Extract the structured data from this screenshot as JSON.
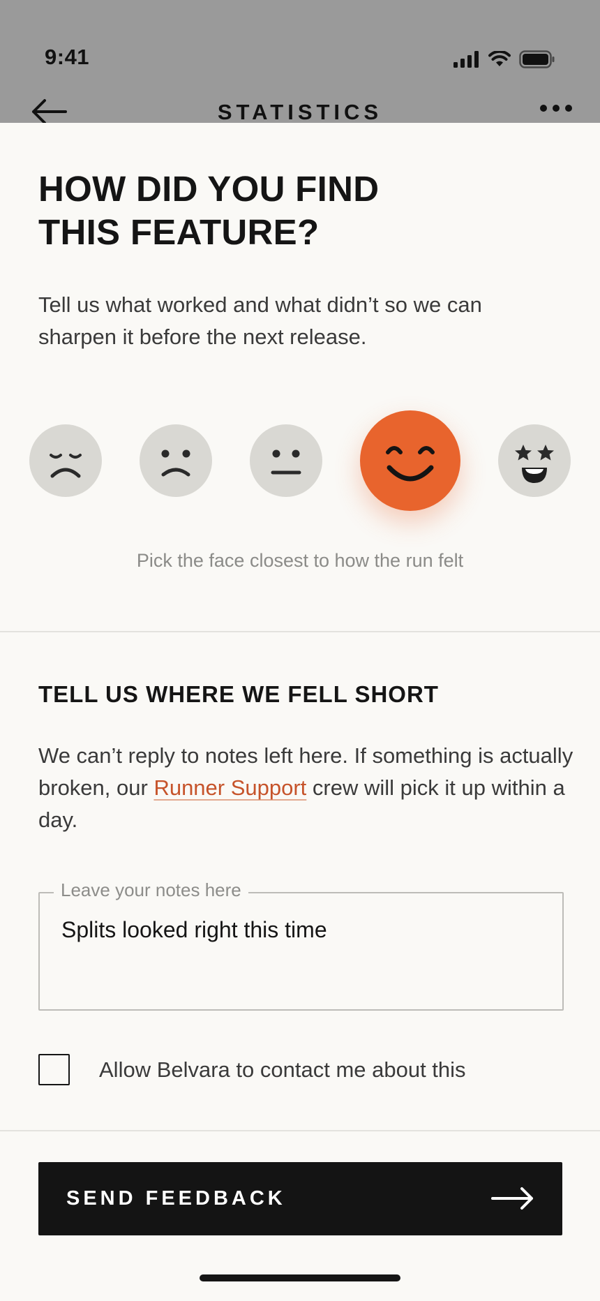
{
  "status_bar": {
    "time": "9:41"
  },
  "nav": {
    "title": "STATISTICS"
  },
  "sheet": {
    "title": "HOW DID YOU FIND\nTHIS FEATURE?",
    "intro": "Tell us what worked and what didn’t so we can sharpen it before the next release.",
    "rating": {
      "options": [
        "very-sad",
        "sad",
        "neutral",
        "happy",
        "very-happy"
      ],
      "selected": "happy",
      "hint": "Pick the face closest to how the run felt"
    },
    "feedback_section": {
      "title": "TELL US WHERE WE FELL SHORT",
      "body_before": "We can’t reply to notes left here. If something is actually broken, our ",
      "link": "Runner Support",
      "body_after": " crew will pick it up within a day."
    },
    "notes": {
      "label": "Leave your notes here",
      "value": "Splits looked right this time"
    },
    "contact_opt_in": {
      "label": "Allow Belvara to contact me about this",
      "checked": false
    },
    "send_button": {
      "label": "SEND FEEDBACK"
    }
  },
  "colors": {
    "accent": "#e8642d",
    "link": "#c6532a",
    "button": "#141414",
    "face_inactive": "#d9d8d3",
    "sheet_bg": "#faf9f6"
  }
}
